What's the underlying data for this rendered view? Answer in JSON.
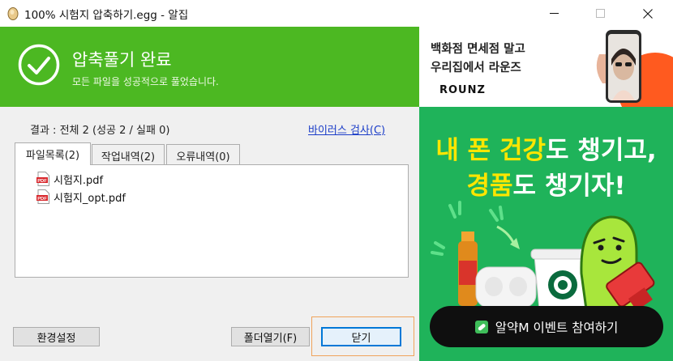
{
  "window": {
    "title": "100% 시험지 압축하기.egg - 알집",
    "controls": {
      "minimize": "─",
      "maximize": "☐",
      "close": "✕"
    }
  },
  "banner": {
    "title": "압축풀기 완료",
    "subtitle": "모든 파일을 성공적으로 풀었습니다.",
    "bg_color": "#4cb822"
  },
  "result": {
    "summary": "결과 : 전체 2 (성공 2 / 실패 0)",
    "virus_scan_link": "바이러스 검사(C)"
  },
  "tabs": [
    {
      "label": "파일목록(2)",
      "active": true
    },
    {
      "label": "작업내역(2)",
      "active": false
    },
    {
      "label": "오류내역(0)",
      "active": false
    }
  ],
  "files": [
    {
      "name": "시험지.pdf",
      "icon": "pdf-icon"
    },
    {
      "name": "시험지_opt.pdf",
      "icon": "pdf-icon"
    }
  ],
  "buttons": {
    "settings": "환경설정",
    "open_folder": "폴더열기(F)",
    "close": "닫기"
  },
  "ad_top": {
    "line1": "백화점 면세점 말고",
    "line2": "우리집에서 라운즈",
    "brand": "ROUNZ"
  },
  "ad_bottom": {
    "headline_1_hl": "내 폰 건강",
    "headline_1_rest": "도 챙기고,",
    "headline_2_hl": "경품",
    "headline_2_rest": "도 챙기자!",
    "cta": "알약M 이벤트 참여하기",
    "bg_color": "#1fb35a",
    "highlight_color": "#ffe600"
  }
}
